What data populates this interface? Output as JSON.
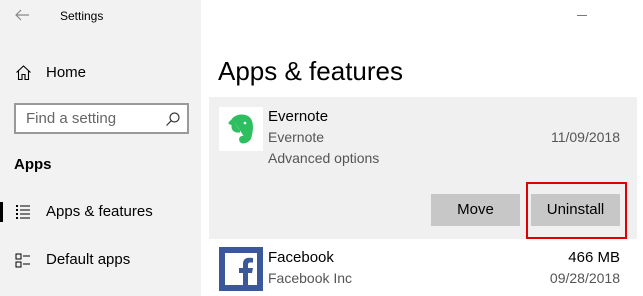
{
  "window": {
    "title": "Settings"
  },
  "sidebar": {
    "home_label": "Home",
    "search_placeholder": "Find a setting",
    "section_label": "Apps",
    "items": [
      {
        "label": "Apps & features",
        "icon": "apps-list-icon",
        "selected": true
      },
      {
        "label": "Default apps",
        "icon": "default-apps-icon",
        "selected": false
      }
    ]
  },
  "main": {
    "title": "Apps & features",
    "apps": [
      {
        "name": "Evernote",
        "publisher": "Evernote",
        "date": "11/09/2018",
        "size": "",
        "link": "Advanced options",
        "icon": "evernote-elephant-icon",
        "icon_color": "#2dbe60",
        "expanded": true,
        "buttons": {
          "move": "Move",
          "uninstall": "Uninstall"
        }
      },
      {
        "name": "Facebook",
        "publisher": "Facebook Inc",
        "date": "09/28/2018",
        "size": "466 MB",
        "icon": "facebook-f-icon",
        "icon_color": "#3b5998",
        "expanded": false
      }
    ]
  },
  "colors": {
    "highlight": "#e00000",
    "sidebar_bg": "#f2f2f2",
    "button_bg": "#c7c7c7"
  }
}
